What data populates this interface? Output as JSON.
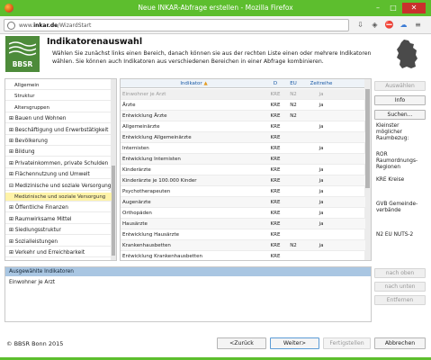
{
  "window": {
    "title": "Neue INKAR-Abfrage erstellen - Mozilla Firefox",
    "min": "–",
    "max": "□",
    "close": "✕",
    "accent_color": "#5dbe2e"
  },
  "browser": {
    "url_prefix": "www.",
    "url_domain": "inkar.de",
    "url_path": "/WizardStart"
  },
  "header": {
    "logo_text": "BBSR",
    "title": "Indikatorenauswahl",
    "description": "Wählen Sie zunächst links einen Bereich, danach können sie aus der rechten Liste einen oder mehrere Indikatoren wählen. Sie können auch Indikatoren aus verschiedenen Bereichen in einer Abfrage kombinieren."
  },
  "sidebar": {
    "items": [
      {
        "label": "Allgemein",
        "sub": true,
        "selected": false
      },
      {
        "label": "Struktur",
        "sub": true,
        "selected": false
      },
      {
        "label": "Altersgruppen",
        "sub": true,
        "selected": false
      },
      {
        "label": "⊞ Bauen und Wohnen",
        "sub": false,
        "selected": false
      },
      {
        "label": "⊞ Beschäftigung und Erwerbstätigkeit",
        "sub": false,
        "selected": false
      },
      {
        "label": "⊞ Bevölkerung",
        "sub": false,
        "selected": false
      },
      {
        "label": "⊞ Bildung",
        "sub": false,
        "selected": false
      },
      {
        "label": "⊞ Privateinkommen, private Schulden",
        "sub": false,
        "selected": false
      },
      {
        "label": "⊞ Flächennutzung und Umwelt",
        "sub": false,
        "selected": false
      },
      {
        "label": "⊟ Medizinische und soziale Versorgung",
        "sub": false,
        "selected": false
      },
      {
        "label": "Medizinische und soziale Versorgung",
        "sub": true,
        "selected": true
      },
      {
        "label": "⊞ Öffentliche Finanzen",
        "sub": false,
        "selected": false
      },
      {
        "label": "⊞ Raumwirksame Mittel",
        "sub": false,
        "selected": false
      },
      {
        "label": "⊞ Siedlungsstruktur",
        "sub": false,
        "selected": false
      },
      {
        "label": "⊞ Sozialleistungen",
        "sub": false,
        "selected": false
      },
      {
        "label": "⊞ Verkehr und Erreichbarkeit",
        "sub": false,
        "selected": false
      }
    ]
  },
  "table": {
    "columns": {
      "indikator": "Indikator",
      "sort": "▲",
      "d": "D",
      "eu": "EU",
      "zeitreihe": "Zeitreihe"
    },
    "rows": [
      {
        "ind": "Einwohner je Arzt",
        "d": "KRE",
        "eu": "N2",
        "zr": "ja"
      },
      {
        "ind": "Ärzte",
        "d": "KRE",
        "eu": "N2",
        "zr": "ja"
      },
      {
        "ind": "Entwicklung Ärzte",
        "d": "KRE",
        "eu": "N2",
        "zr": ""
      },
      {
        "ind": "Allgemeinärzte",
        "d": "KRE",
        "eu": "",
        "zr": "ja"
      },
      {
        "ind": "Entwicklung Allgemeinärzte",
        "d": "KRE",
        "eu": "",
        "zr": ""
      },
      {
        "ind": "Internisten",
        "d": "KRE",
        "eu": "",
        "zr": "ja"
      },
      {
        "ind": "Entwicklung Internisten",
        "d": "KRE",
        "eu": "",
        "zr": ""
      },
      {
        "ind": "Kinderärzte",
        "d": "KRE",
        "eu": "",
        "zr": "ja"
      },
      {
        "ind": "Kinderärzte je 100.000 Kinder",
        "d": "KRE",
        "eu": "",
        "zr": "ja"
      },
      {
        "ind": "Psychotherapeuten",
        "d": "KRE",
        "eu": "",
        "zr": "ja"
      },
      {
        "ind": "Augenärzte",
        "d": "KRE",
        "eu": "",
        "zr": "ja"
      },
      {
        "ind": "Orthopäden",
        "d": "KRE",
        "eu": "",
        "zr": "ja"
      },
      {
        "ind": "Hausärzte",
        "d": "KRE",
        "eu": "",
        "zr": "ja"
      },
      {
        "ind": "Entwicklung Hausärzte",
        "d": "KRE",
        "eu": "",
        "zr": ""
      },
      {
        "ind": "Krankenhausbetten",
        "d": "KRE",
        "eu": "N2",
        "zr": "ja"
      },
      {
        "ind": "Entwicklung Krankenhausbetten",
        "d": "KRE",
        "eu": "",
        "zr": ""
      }
    ]
  },
  "rightpanel": {
    "auswahlen": "Auswählen",
    "info": "Info",
    "suchen": "Suchen...",
    "kleinster_label": "Kleinster möglicher Raumbezug:",
    "ror": "ROR Raumordnungs-Regionen",
    "kre": "KRE Kreise",
    "gvb": "GVB Gemeinde-verbände",
    "n2": "N2 EU NUTS-2"
  },
  "selected": {
    "header": "Ausgewählte Indikatoren",
    "items": [
      "Einwohner je Arzt"
    ],
    "nach_oben": "nach oben",
    "nach_unten": "nach unten",
    "entfernen": "Entfernen"
  },
  "footer": {
    "copyright": "© BBSR Bonn 2015",
    "zuruck": "<Zurück",
    "weiter": "Weiter>",
    "fertig": "Fertigstellen",
    "abbrechen": "Abbrechen"
  }
}
